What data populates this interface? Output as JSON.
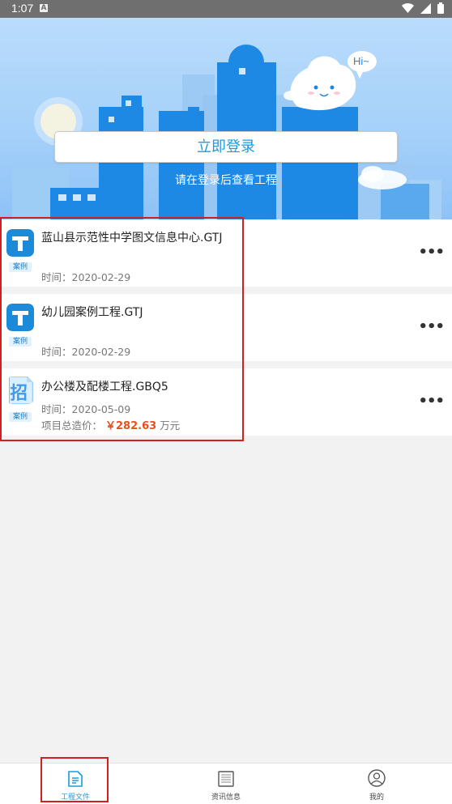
{
  "status_bar": {
    "time": "1:07",
    "notification": "A"
  },
  "header": {
    "bubble_text": "Hi~",
    "login_button": "立即登录",
    "login_tip": "请在登录后查看工程"
  },
  "projects": [
    {
      "title": "蓝山县示范性中学图文信息中心.GTJ",
      "badge": "案例",
      "time": "时间：2020-02-29",
      "icon": "gtj-app-icon"
    },
    {
      "title": "幼儿园案例工程.GTJ",
      "badge": "案例",
      "time": "时间：2020-02-29",
      "icon": "gtj-app-icon"
    },
    {
      "title": "办公楼及配楼工程.GBQ5",
      "badge": "案例",
      "time": "时间：2020-05-09",
      "price_label": "项目总造价：",
      "price_value": "￥282.63",
      "price_unit": "万元",
      "icon": "gbq-bid-icon"
    }
  ],
  "more_label": "•••",
  "bottom_nav": [
    {
      "label": "工程文件",
      "active": true
    },
    {
      "label": "资讯信息",
      "active": false
    },
    {
      "label": "我的",
      "active": false
    }
  ],
  "colors": {
    "accent": "#1a9be0",
    "price": "#e8501f",
    "highlight_box": "#d22020"
  }
}
